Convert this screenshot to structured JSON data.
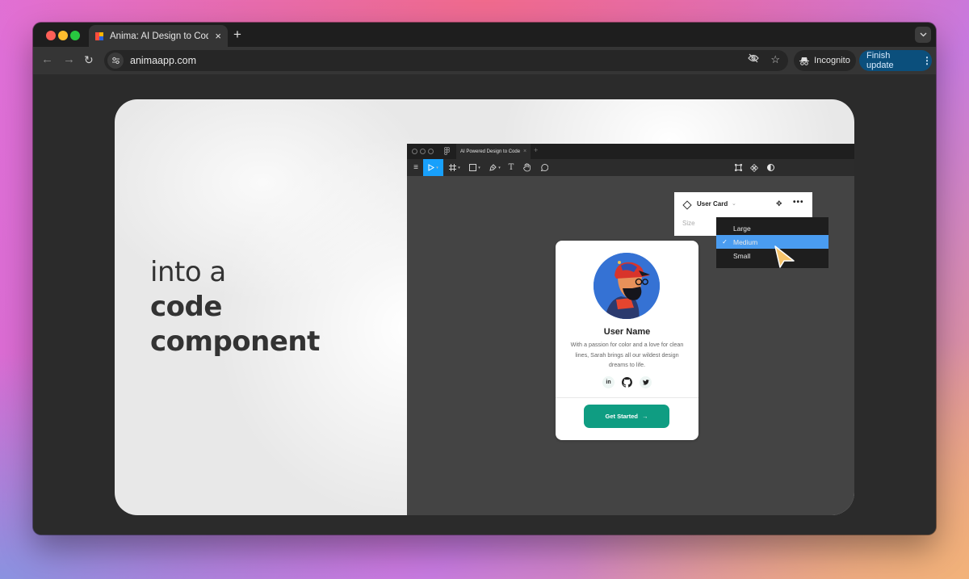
{
  "browser": {
    "tab": {
      "title": "Anima: AI Design to Code | Fig",
      "favicon": "anima-favicon",
      "close_icon": "×"
    },
    "new_tab_icon": "+",
    "tab_menu_icon": "⌄",
    "nav": {
      "back_icon": "←",
      "forward_icon": "→",
      "reload_icon": "↻"
    },
    "address_bar": {
      "url": "animaapp.com",
      "site_info_icon": "tune-icon"
    },
    "omnibox_icons": {
      "eye_off": "eye-off-icon",
      "star": "☆"
    },
    "incognito_label": "Incognito",
    "finish_update_label": "Finish update",
    "menu_icon": "⋮"
  },
  "hero": {
    "line1": "into a",
    "line2": "code",
    "line3": "component"
  },
  "figma": {
    "tab_title": "AI Powered Design to Code",
    "tab_close": "×",
    "new_tab": "+",
    "tools": {
      "menu": "≡",
      "text": "T",
      "hand": "✋"
    },
    "props_panel": {
      "component_name": "User Card",
      "caret": "⌄",
      "more": "•••",
      "move_icon": "✥",
      "size_label": "Size"
    },
    "size_dropdown": {
      "options": [
        "Large",
        "Medium",
        "Small"
      ],
      "selected": "Medium",
      "check": "✓"
    },
    "accent_color": "#18a0fb",
    "selected_color": "#4a9cf0"
  },
  "user_card": {
    "name": "User Name",
    "bio": "With a passion for color and a love for clean lines, Sarah brings all our wildest design dreams to life.",
    "socials": [
      {
        "name": "linkedin",
        "glyph": "in"
      },
      {
        "name": "github",
        "glyph": "github"
      },
      {
        "name": "twitter",
        "glyph": "twitter"
      }
    ],
    "cta_label": "Get Started",
    "cta_arrow": "→",
    "cta_color": "#0f9d82",
    "avatar_bg": "#3572d4"
  }
}
